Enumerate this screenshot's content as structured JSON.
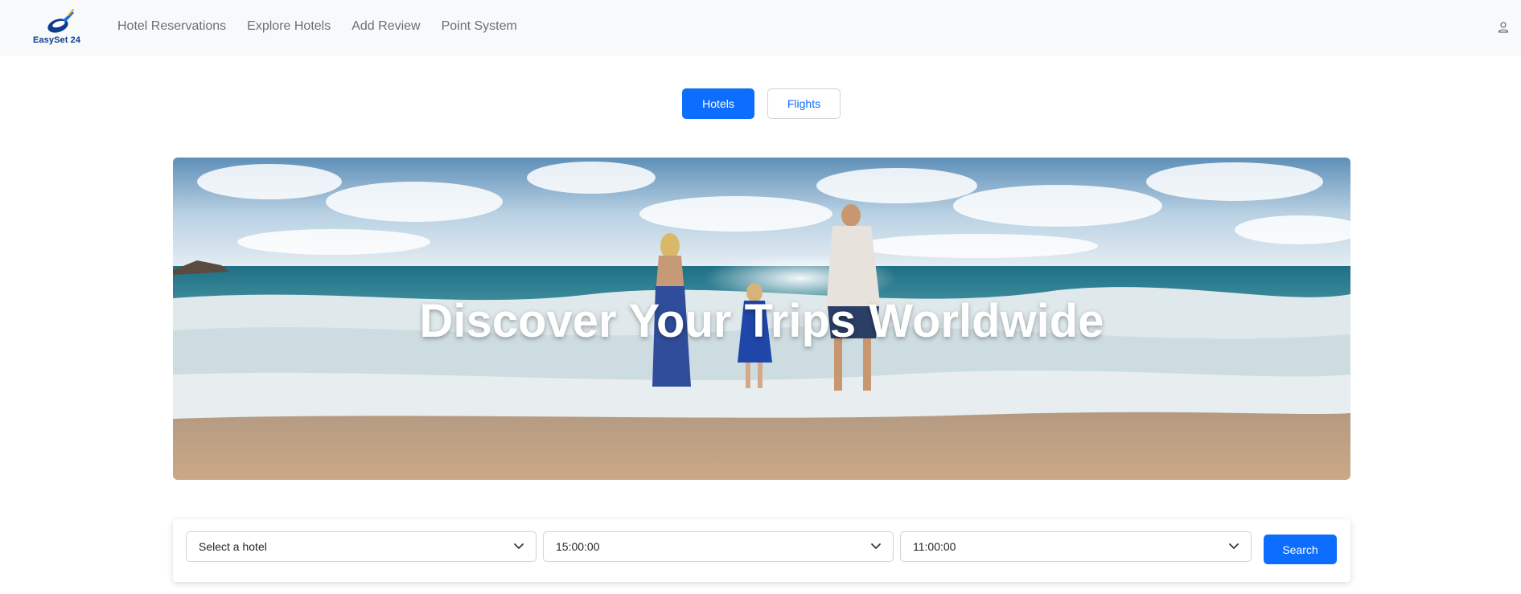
{
  "brand": {
    "name": "EasySet 24",
    "logo_icon": "plane-globe-logo",
    "colors": {
      "primary": "#0d3d8c",
      "accent": "#f5a623"
    }
  },
  "nav": {
    "items": [
      {
        "label": "Hotel Reservations"
      },
      {
        "label": "Explore Hotels"
      },
      {
        "label": "Add Review"
      },
      {
        "label": "Point System"
      }
    ],
    "user_icon": "user-icon"
  },
  "mode_toggle": {
    "hotels_label": "Hotels",
    "flights_label": "Flights",
    "active": "Hotels",
    "active_color": "#0d6efd"
  },
  "hero": {
    "title": "Discover Your Trips Worldwide",
    "image": "family-on-beach-photo"
  },
  "search": {
    "hotel_select": {
      "value": "Select a hotel"
    },
    "checkin_select": {
      "value": "15:00:00"
    },
    "checkout_select": {
      "value": "11:00:00"
    },
    "search_label": "Search",
    "chevron_icon": "chevron-down-icon"
  }
}
